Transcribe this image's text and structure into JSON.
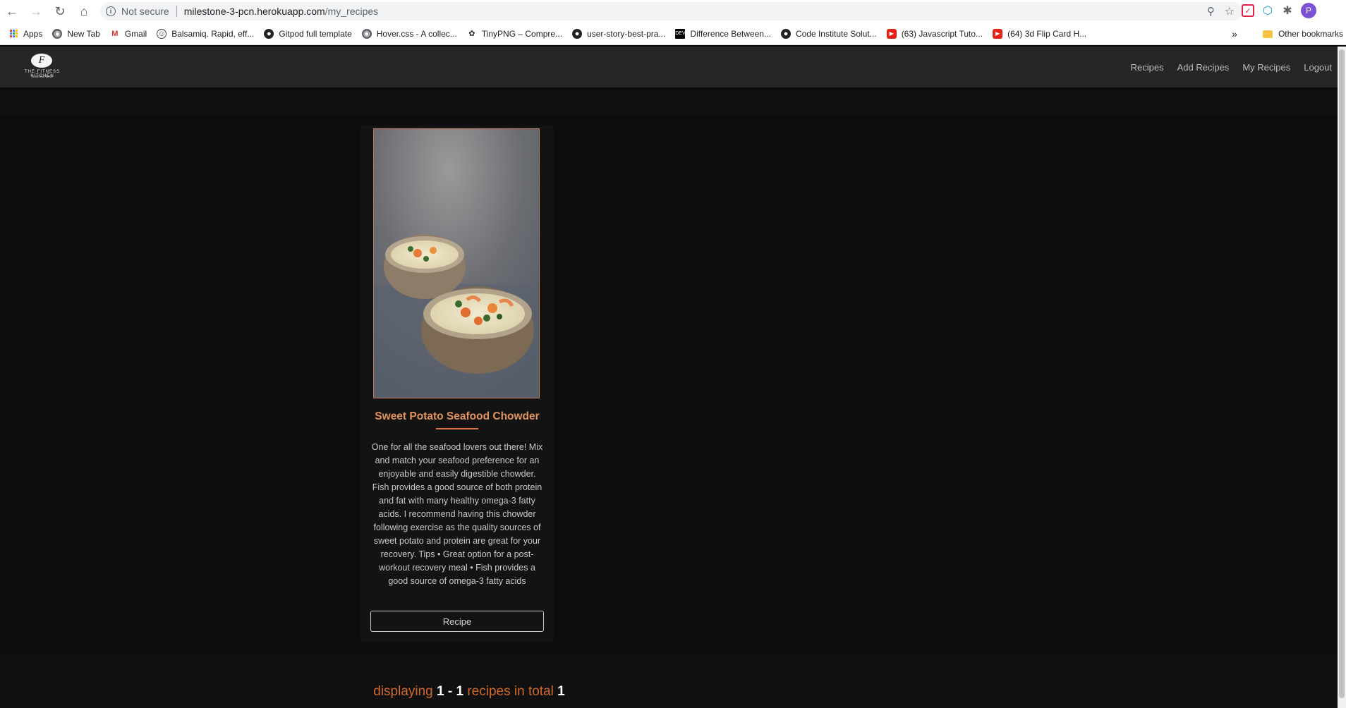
{
  "browser": {
    "security_label": "Not secure",
    "url_host": "milestone-3-pcn.herokuapp.com",
    "url_path": "/my_recipes",
    "profile_initial": "P"
  },
  "bookmarks": {
    "items": [
      {
        "label": "Apps",
        "icon": "apps-grid-icon"
      },
      {
        "label": "New Tab",
        "icon": "globe-icon"
      },
      {
        "label": "Gmail",
        "icon": "gmail-icon"
      },
      {
        "label": "Balsamiq. Rapid, eff...",
        "icon": "balsamiq-icon"
      },
      {
        "label": "Gitpod full template",
        "icon": "github-icon"
      },
      {
        "label": "Hover.css - A collec...",
        "icon": "globe-icon"
      },
      {
        "label": "TinyPNG – Compre...",
        "icon": "panda-icon"
      },
      {
        "label": "user-story-best-pra...",
        "icon": "github-icon"
      },
      {
        "label": "Difference Between...",
        "icon": "dev-icon"
      },
      {
        "label": "Code Institute Solut...",
        "icon": "github-icon"
      },
      {
        "label": "(63) Javascript Tuto...",
        "icon": "youtube-icon"
      },
      {
        "label": "(64) 3d Flip Card H...",
        "icon": "youtube-icon"
      }
    ],
    "more_label": "»",
    "other_label": "Other bookmarks"
  },
  "site": {
    "logo_mark": "F",
    "logo_brand": "THE FITNESS KITCHEN",
    "logo_tagline": "food that fuels",
    "nav": [
      "Recipes",
      "Add Recipes",
      "My Recipes",
      "Logout"
    ]
  },
  "recipe": {
    "title": "Sweet Potato Seafood Chowder",
    "description": "One for all the seafood lovers out there! Mix and match your seafood preference for an enjoyable and easily digestible chowder. Fish provides a good source of both protein and fat with many healthy omega-3 fatty acids. I recommend having this chowder following exercise as the quality sources of sweet potato and protein are great for your recovery. Tips • Great option for a post-workout recovery meal • Fish provides a good source of omega-3 fatty acids",
    "button_label": "Recipe"
  },
  "pagination": {
    "prefix": "displaying",
    "start": "1",
    "dash": "-",
    "end": "1",
    "middle": "recipes in total",
    "total": "1"
  },
  "colors": {
    "accent": "#e3925a",
    "underline": "#e0733a",
    "pagination_text": "#d06a2c",
    "navbar_bg": "#262626",
    "page_bg": "#101010"
  }
}
